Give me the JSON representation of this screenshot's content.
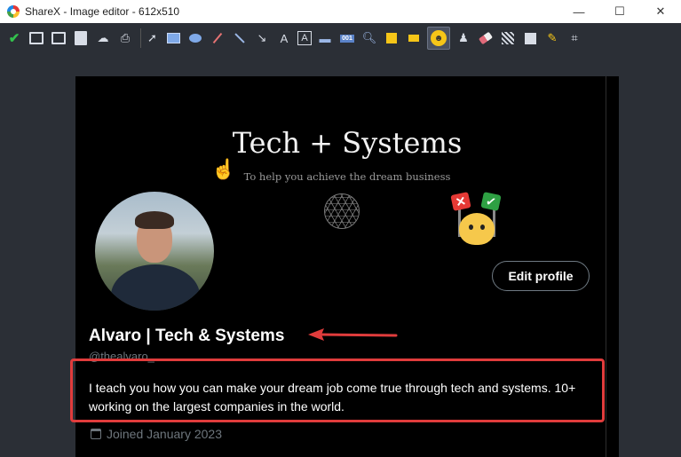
{
  "window": {
    "title": "ShareX - Image editor - 612x510",
    "controls": {
      "minimize": "—",
      "maximize": "☐",
      "close": "✕"
    }
  },
  "toolbar": {
    "tools": [
      "confirm-icon",
      "save-icon",
      "save-as-icon",
      "copy-icon",
      "upload-icon",
      "print-icon",
      "select-icon",
      "rectangle-icon",
      "ellipse-icon",
      "freehand-icon",
      "line-icon",
      "arrow-icon",
      "text-outline-icon",
      "text-background-icon",
      "speech-balloon-icon",
      "step-icon",
      "magnify-icon",
      "image-icon",
      "sticker-icon",
      "emoji-icon",
      "cursor-stamp-icon",
      "eraser-icon",
      "blur-icon",
      "pixelate-icon",
      "highlight-icon",
      "crop-icon"
    ],
    "active_tool": "emoji-icon"
  },
  "profile": {
    "banner_title": "Tech + Systems",
    "banner_subtitle": "To help you achieve the dream business",
    "edit_button": "Edit profile",
    "name": "Alvaro | Tech & Systems",
    "handle": "@thealvaro_",
    "bio": "I teach you how you can make your dream job come true through tech and systems. 10+ working on the largest companies in the world.",
    "joined": "Joined January 2023"
  },
  "annotations": {
    "color": "#e03c3c"
  }
}
